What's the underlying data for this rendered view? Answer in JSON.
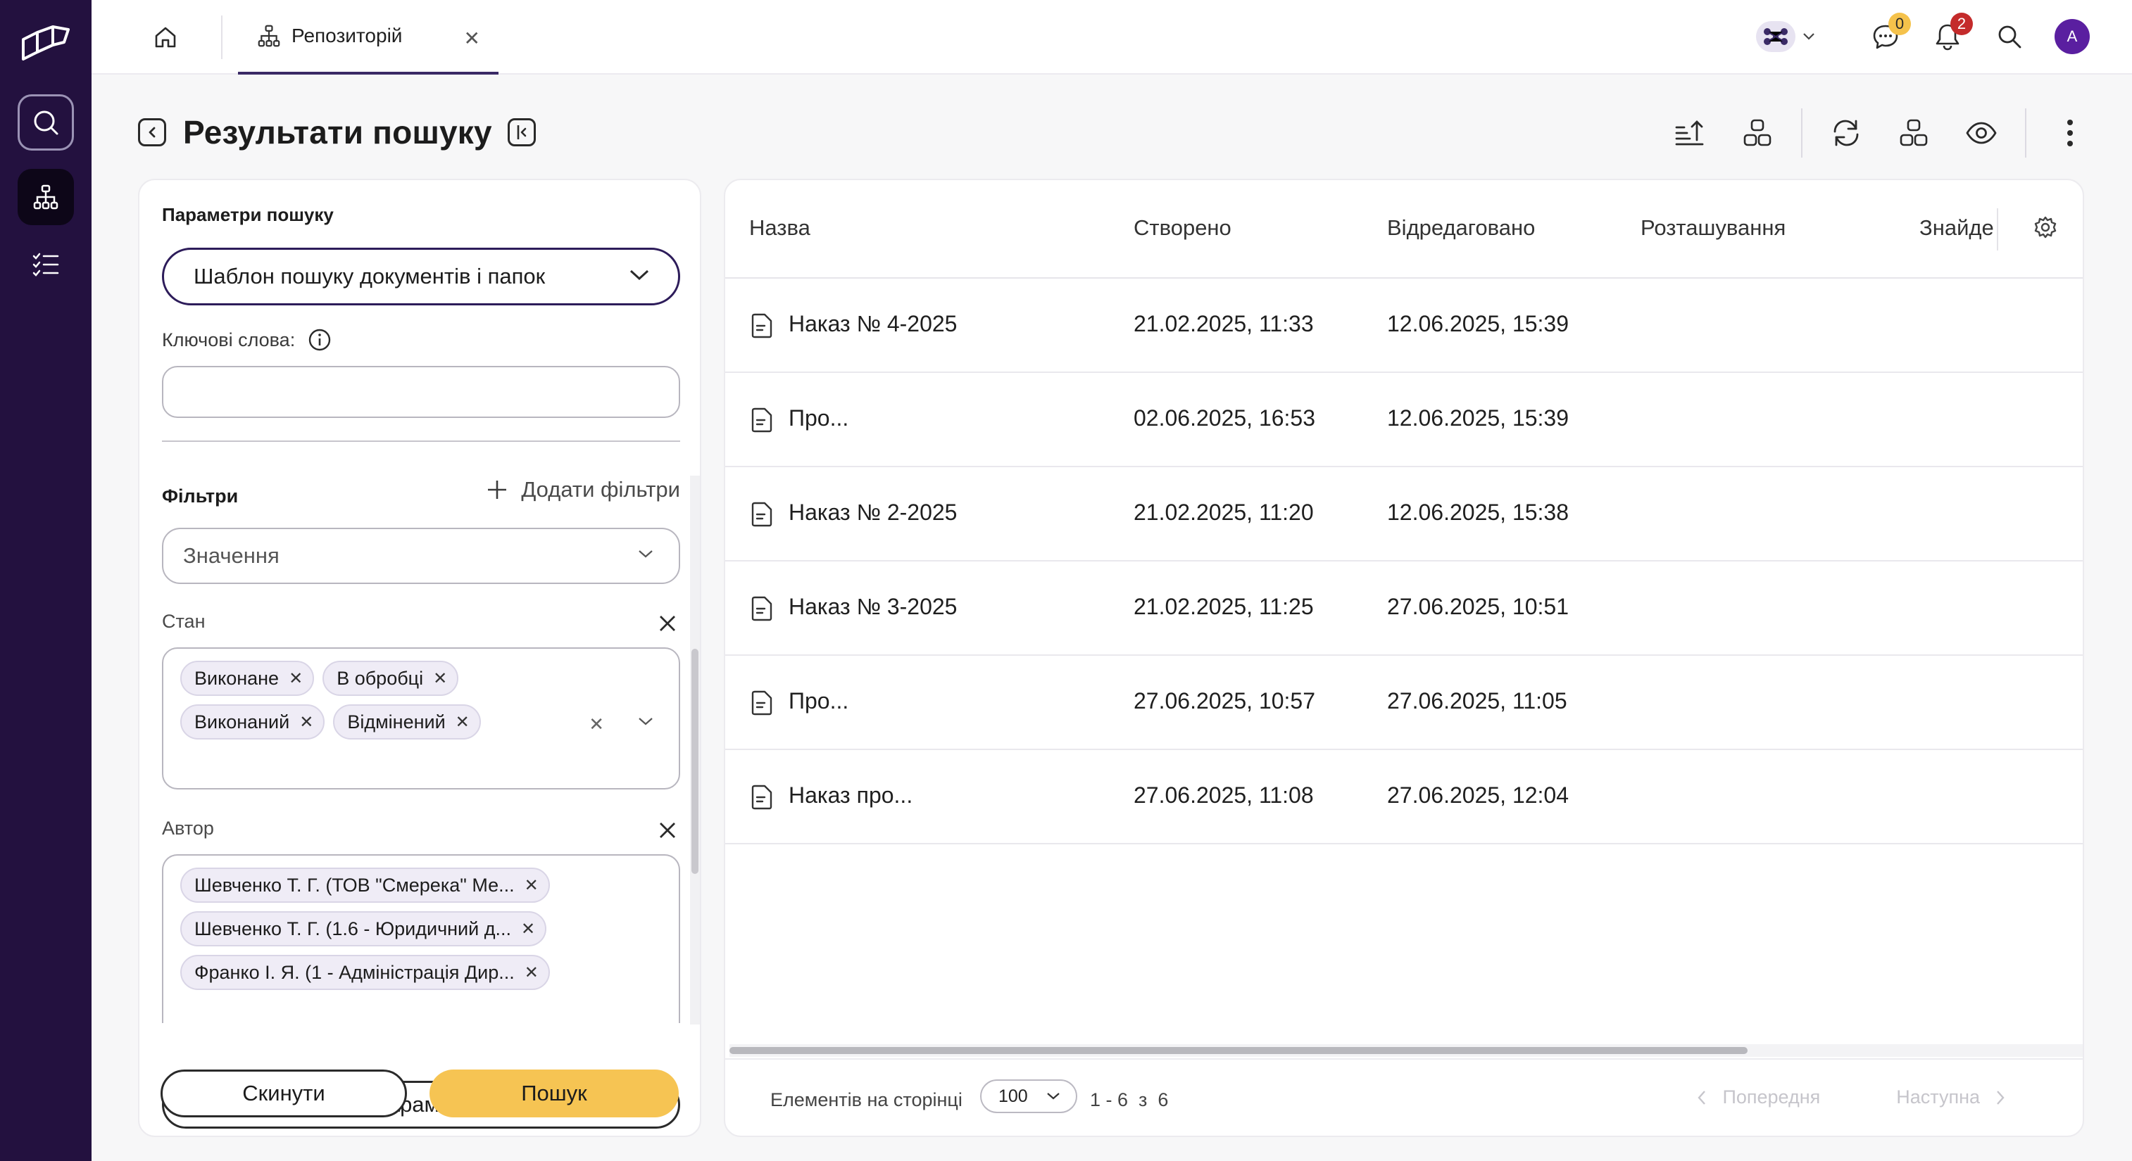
{
  "tab": {
    "label": "Репозиторій"
  },
  "badges": {
    "messages": "0",
    "notifications": "2"
  },
  "user": {
    "initial": "A"
  },
  "page": {
    "title": "Результати пошуку"
  },
  "search_panel": {
    "title": "Параметри пошуку",
    "template": "Шаблон пошуку документів і папок",
    "keywords_label": "Ключові слова:",
    "keywords_value": "",
    "filters_label": "Фільтри",
    "add_filters": "Додати фільтри",
    "value_placeholder": "Значення",
    "state": {
      "label": "Стан",
      "chips": [
        "Виконане",
        "В обробці",
        "Виконаний",
        "Відмінений"
      ]
    },
    "author": {
      "label": "Автор",
      "chips": [
        "Шевченко Т. Г. (ТОВ \"Смерека\" Ме...",
        "Шевченко Т. Г. (1.6 - Юридичний д...",
        "Франко І. Я. (1 - Адміністрація Дир..."
      ]
    },
    "save_label": "Зберегти параметри пошуку",
    "reset_label": "Скинути",
    "search_label": "Пошук"
  },
  "table": {
    "columns": [
      "Назва",
      "Створено",
      "Відредаговано",
      "Розташування",
      "Знайде"
    ],
    "rows": [
      {
        "name": "Наказ № 4-2025",
        "created": "21.02.2025, 11:33",
        "edited": "12.06.2025, 15:39"
      },
      {
        "name": "Про...",
        "created": "02.06.2025, 16:53",
        "edited": "12.06.2025, 15:39"
      },
      {
        "name": "Наказ № 2-2025",
        "created": "21.02.2025, 11:20",
        "edited": "12.06.2025, 15:38"
      },
      {
        "name": "Наказ № 3-2025",
        "created": "21.02.2025, 11:25",
        "edited": "27.06.2025, 10:51"
      },
      {
        "name": "Про...",
        "created": "27.06.2025, 10:57",
        "edited": "27.06.2025, 11:05"
      },
      {
        "name": "Наказ про...",
        "created": "27.06.2025, 11:08",
        "edited": "27.06.2025, 12:04"
      }
    ]
  },
  "pagination": {
    "per_page_label": "Елементів на сторінці",
    "per_page_value": "100",
    "range": "1 - 6  з  6",
    "prev": "Попередня",
    "next": "Наступна"
  }
}
